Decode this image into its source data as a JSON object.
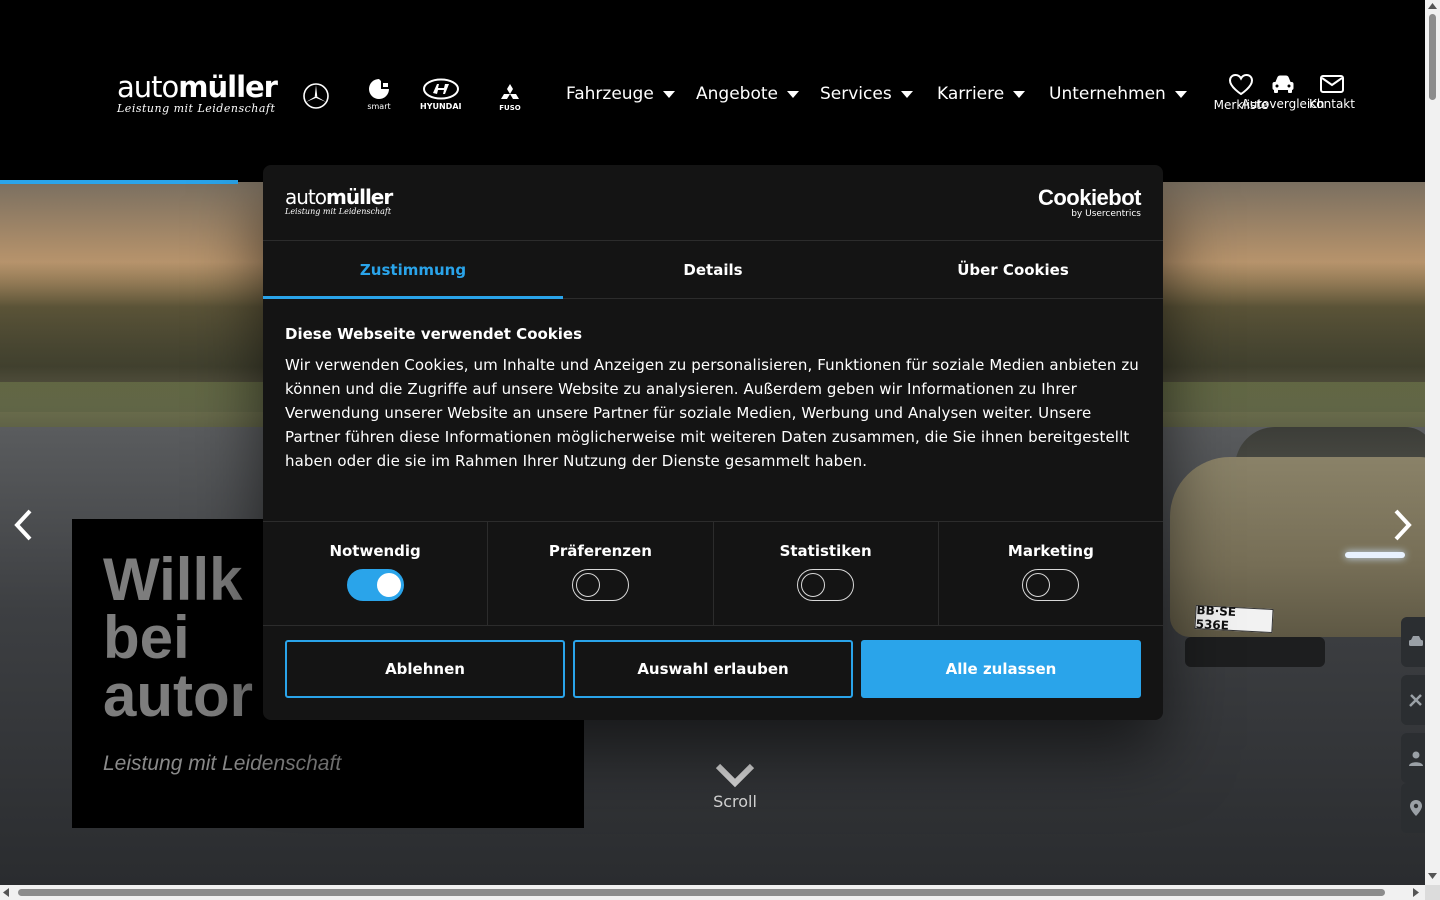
{
  "header": {
    "logo_word_light": "auto",
    "logo_word_bold": "müller",
    "logo_tagline": "Leistung mit Leidenschaft",
    "brands": [
      {
        "name": "mercedes-benz",
        "caption": ""
      },
      {
        "name": "smart",
        "caption": "smart"
      },
      {
        "name": "hyundai",
        "caption": "HYUNDAI"
      },
      {
        "name": "fuso",
        "caption": "FUSO"
      }
    ],
    "nav": [
      {
        "label": "Fahrzeuge"
      },
      {
        "label": "Angebote"
      },
      {
        "label": "Services"
      },
      {
        "label": "Karriere"
      },
      {
        "label": "Unternehmen"
      }
    ],
    "actions": [
      {
        "label": "Merkliste",
        "icon": "heart-icon"
      },
      {
        "label": "Autovergleich",
        "icon": "car-icon"
      },
      {
        "label": "Kontakt",
        "icon": "mail-icon"
      }
    ]
  },
  "hero": {
    "title": "Willkommen bei automüller",
    "title_visible_lines": [
      "Willk",
      "bei",
      "autor"
    ],
    "subtitle": "Leistung mit Leidenschaft",
    "scroll_label": "Scroll",
    "plate_text": "BB·SE 536E",
    "slide_progress": 0.167
  },
  "cookie": {
    "logo_word_light": "auto",
    "logo_word_bold": "müller",
    "logo_tagline": "Leistung mit Leidenschaft",
    "cookiebot_word": "Cookiebot",
    "cookiebot_by": "by Usercentrics",
    "tabs": [
      {
        "label": "Zustimmung",
        "active": true
      },
      {
        "label": "Details",
        "active": false
      },
      {
        "label": "Über Cookies",
        "active": false
      }
    ],
    "title": "Diese Webseite verwendet Cookies",
    "text": "Wir verwenden Cookies, um Inhalte und Anzeigen zu personalisieren, Funktionen für soziale Medien anbieten zu können und die Zugriffe auf unsere Website zu analysieren. Außerdem geben wir Informationen zu Ihrer Verwendung unserer Website an unsere Partner für soziale Medien, Werbung und Analysen weiter. Unsere Partner führen diese Informationen möglicherweise mit weiteren Daten zusammen, die Sie ihnen bereitgestellt haben oder die sie im Rahmen Ihrer Nutzung der Dienste gesammelt haben.",
    "categories": [
      {
        "label": "Notwendig",
        "on": true
      },
      {
        "label": "Präferenzen",
        "on": false
      },
      {
        "label": "Statistiken",
        "on": false
      },
      {
        "label": "Marketing",
        "on": false
      }
    ],
    "buttons": {
      "reject": "Ablehnen",
      "allow_selection": "Auswahl erlauben",
      "allow_all": "Alle zulassen"
    }
  },
  "colors": {
    "accent": "#2aa4ea",
    "dialog_bg": "#141414",
    "header_bg": "#000000"
  }
}
